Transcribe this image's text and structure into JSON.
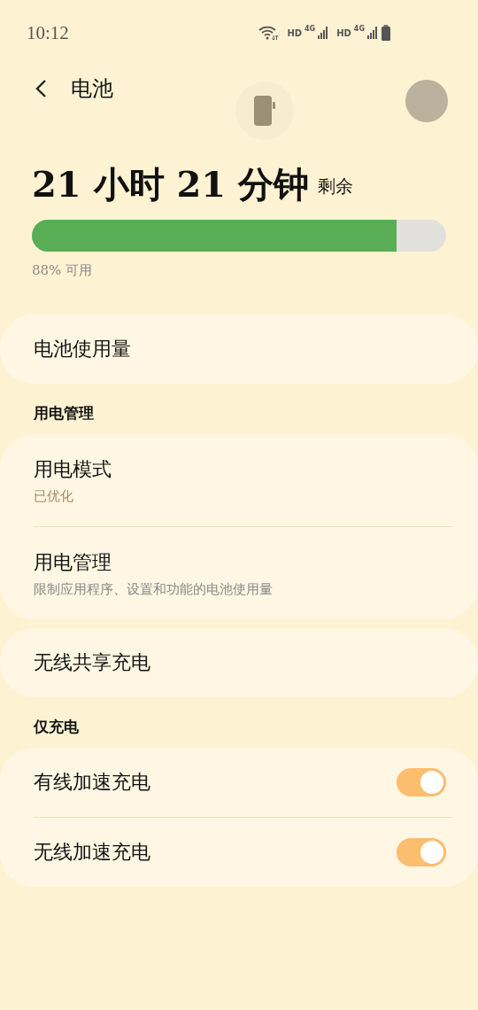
{
  "status_bar": {
    "time": "10:12",
    "networks": [
      {
        "label": "HD",
        "type": "4G"
      },
      {
        "label": "HD",
        "type": "4G"
      }
    ]
  },
  "header": {
    "title": "电池"
  },
  "remaining": {
    "value": "21 小时 21 分钟",
    "suffix": "剩余"
  },
  "battery": {
    "level": 0.88,
    "caption": "88% 可用"
  },
  "groups": [
    {
      "items": [
        {
          "kind": "link",
          "title": "电池使用量"
        }
      ]
    },
    {
      "heading": "用电管理",
      "items": [
        {
          "kind": "link",
          "title": "用电模式",
          "subtitle": "已优化",
          "highlighted": true
        },
        {
          "kind": "link",
          "title": "用电管理",
          "subtitle": "限制应用程序、设置和功能的电池使用量",
          "highlighted": false
        }
      ]
    },
    {
      "items": [
        {
          "kind": "link",
          "title": "无线共享充电"
        }
      ]
    },
    {
      "heading": "仅充电",
      "items": [
        {
          "kind": "toggle",
          "title": "有线加速充电",
          "on": true
        },
        {
          "kind": "toggle",
          "title": "无线加速充电",
          "on": true
        }
      ]
    }
  ]
}
